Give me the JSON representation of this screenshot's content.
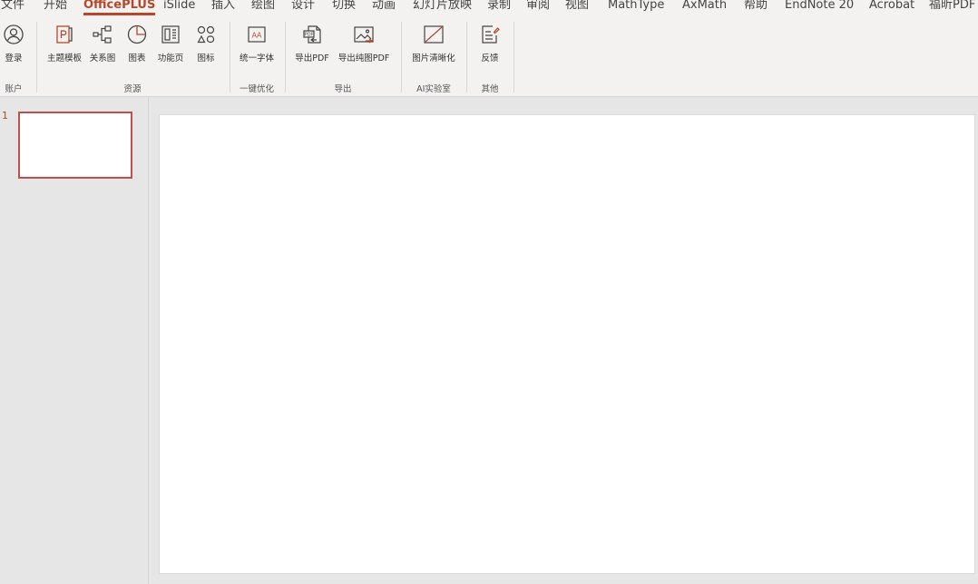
{
  "tabs": [
    "文件",
    "开始",
    "OfficePLUS",
    "iSlide",
    "插入",
    "绘图",
    "设计",
    "切换",
    "动画",
    "幻灯片放映",
    "录制",
    "审阅",
    "视图",
    "MathType",
    "AxMath",
    "帮助",
    "EndNote 20",
    "Acrobat",
    "福昕PDF"
  ],
  "active_tab": "OfficePLUS",
  "ribbon": {
    "login": {
      "label": "登录",
      "icon": "user-icon"
    },
    "theme_template": {
      "label": "主题模板",
      "icon": "template-icon"
    },
    "relation_chart": {
      "label": "关系图",
      "icon": "relation-icon"
    },
    "chart": {
      "label": "图表",
      "icon": "pie-icon"
    },
    "function_page": {
      "label": "功能页",
      "icon": "function-page-icon"
    },
    "icons": {
      "label": "图标",
      "icon": "shapes-icon"
    },
    "unify_font": {
      "label": "统一字体",
      "icon": "font-icon"
    },
    "export_pdf": {
      "label": "导出PDF",
      "icon": "pdf-icon"
    },
    "export_image_pdf": {
      "label": "导出纯图PDF",
      "icon": "image-pdf-icon"
    },
    "image_clarify": {
      "label": "图片清晰化",
      "icon": "image-clarify-icon"
    },
    "feedback": {
      "label": "反馈",
      "icon": "feedback-icon"
    },
    "groups": {
      "account": "账户",
      "resources": "资源",
      "optimize": "一键优化",
      "export": "导出",
      "ai_lab": "AI实验室",
      "other": "其他"
    }
  },
  "slides": [
    {
      "number": "1"
    }
  ],
  "colors": {
    "accent": "#b7472a",
    "ribbon_bg": "#f3f2f1",
    "workspace_bg": "#e6e6e6",
    "selected_border": "#c0504d"
  }
}
